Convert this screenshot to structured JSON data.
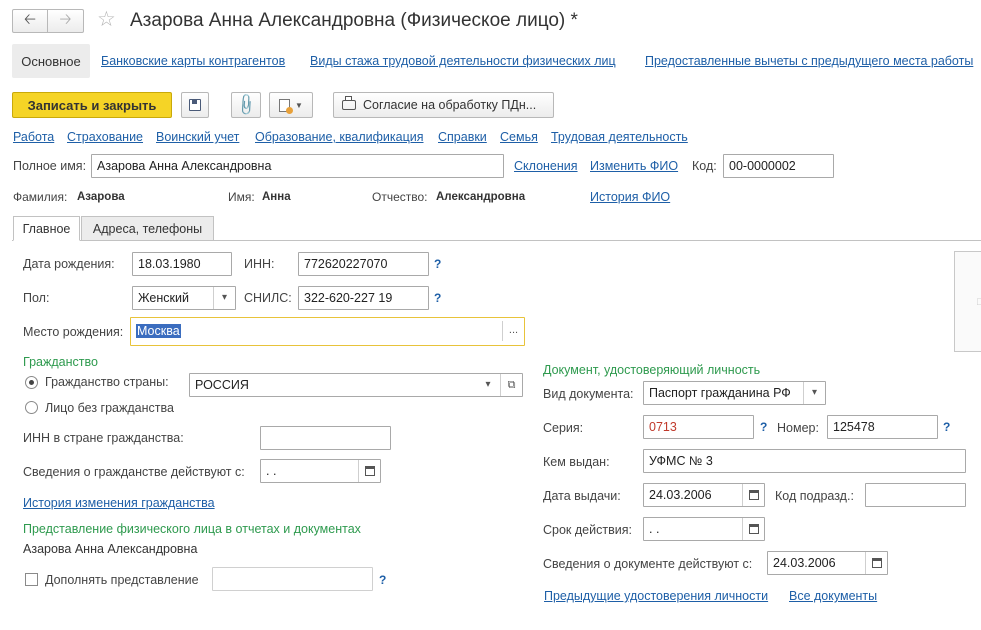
{
  "window": {
    "title": "Азарова Анна Александровна (Физическое лицо) *"
  },
  "nav_tabs": [
    {
      "label": "Основное"
    },
    {
      "label": "Банковские карты контрагентов"
    },
    {
      "label": "Виды стажа трудовой деятельности физических лиц"
    },
    {
      "label": "Предоставленные вычеты с предыдущего места работы"
    }
  ],
  "toolbar": {
    "save_close_label": "Записать и закрыть",
    "consent_label": "Согласие на обработку ПДн..."
  },
  "sections": [
    "Работа",
    "Страхование",
    "Воинский учет",
    "Образование, квалификация",
    "Справки",
    "Семья",
    "Трудовая деятельность"
  ],
  "full_name": {
    "label": "Полное имя:",
    "value": "Азарова Анна Александровна",
    "declensions_link": "Склонения",
    "change_fio_link": "Изменить ФИО",
    "code_label": "Код:",
    "code_value": "00-0000002"
  },
  "fio": {
    "surname_label": "Фамилия:",
    "surname": "Азарова",
    "name_label": "Имя:",
    "name": "Анна",
    "patronymic_label": "Отчество:",
    "patronymic": "Александровна",
    "history_link": "История ФИО"
  },
  "inner_tabs": [
    {
      "label": "Главное"
    },
    {
      "label": "Адреса, телефоны"
    }
  ],
  "main": {
    "birth_date_label": "Дата рождения:",
    "birth_date": "18.03.1980",
    "inn_label": "ИНН:",
    "inn": "772620227070",
    "gender_label": "Пол:",
    "gender": "Женский",
    "snils_label": "СНИЛС:",
    "snils": "322-620-227 19",
    "birthplace_label": "Место рождения:",
    "birthplace": "Москва",
    "help_mark": "?"
  },
  "citizenship": {
    "group_title": "Гражданство",
    "country_option": "Гражданство страны:",
    "country": "РОССИЯ",
    "stateless_option": "Лицо без гражданства",
    "inn_country_label": "ИНН в стране гражданства:",
    "inn_country": "",
    "valid_from_label": "Сведения о гражданстве действуют с:",
    "valid_from": " .  .",
    "history_link": "История изменения гражданства"
  },
  "representation": {
    "group_title": "Представление физического лица в отчетах и документах",
    "value": "Азарова Анна Александровна",
    "supplement_label": "Дополнять представление",
    "supplement_value": ""
  },
  "document": {
    "group_title": "Документ, удостоверяющий личность",
    "type_label": "Вид документа:",
    "type": "Паспорт гражданина РФ",
    "series_label": "Серия:",
    "series": "0713",
    "number_label": "Номер:",
    "number": "125478",
    "issued_by_label": "Кем выдан:",
    "issued_by": "УФМС № 3",
    "issue_date_label": "Дата выдачи:",
    "issue_date": "24.03.2006",
    "subdivision_label": "Код подразд.:",
    "subdivision": "",
    "validity_label": "Срок действия:",
    "validity": " .  .",
    "valid_from_label": "Сведения о документе действуют с:",
    "valid_from": "24.03.2006",
    "prev_docs_link": "Предыдущие удостоверения личности",
    "all_docs_link": "Все документы"
  },
  "colors": {
    "accent_yellow": "#f5d426",
    "link_blue": "#1e5fa7",
    "group_green": "#2e9a4e",
    "series_red": "#c0392b"
  }
}
